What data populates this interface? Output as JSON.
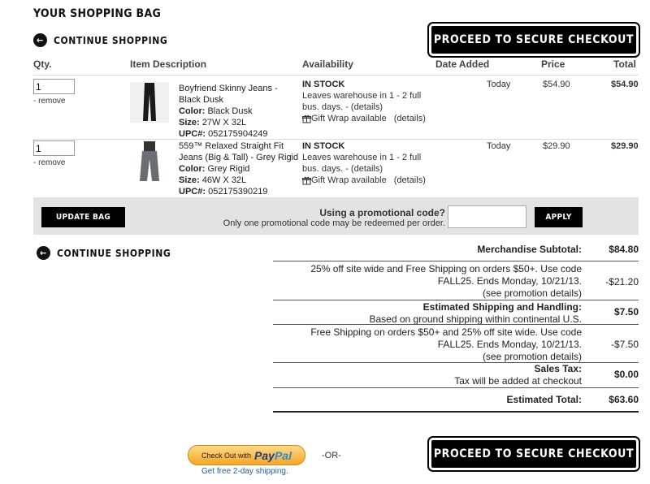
{
  "page_title": "YOUR SHOPPING BAG",
  "continue_shopping": "CONTINUE SHOPPING",
  "checkout_button": "PROCEED TO SECURE CHECKOUT",
  "columns": {
    "qty": "Qty.",
    "item": "Item Description",
    "availability": "Availability",
    "date_added": "Date Added",
    "price": "Price",
    "total": "Total"
  },
  "items": [
    {
      "qty": "1",
      "remove": "- remove",
      "name": "Boyfriend Skinny Jeans - Black Dusk",
      "color_label": "Color:",
      "color": "Black Dusk",
      "size_label": "Size:",
      "size": "27W X 32L",
      "upc_label": "UPC#:",
      "upc": "052175904249",
      "stock": "IN STOCK",
      "leaves": "Leaves warehouse in 1 - 2 full bus. days. - (",
      "details": "details",
      "close_paren": ")",
      "gift_wrap": "Gift Wrap available",
      "gift_details": "(details)",
      "date": "Today",
      "price": "$54.90",
      "total": "$54.90"
    },
    {
      "qty": "1",
      "remove": "- remove",
      "name": "559™ Relaxed Straight Fit Jeans (Big & Tall) - Grey Rigid",
      "color_label": "Color:",
      "color": "Grey Rigid",
      "size_label": "Size:",
      "size": "46W X 32L",
      "upc_label": "UPC#:",
      "upc": "052175390219",
      "stock": "IN STOCK",
      "leaves": "Leaves warehouse in 1 - 2 full bus. days. - (",
      "details": "details",
      "close_paren": ")",
      "gift_wrap": "Gift Wrap available",
      "gift_details": "(details)",
      "date": "Today",
      "price": "$29.90",
      "total": "$29.90"
    }
  ],
  "update_bag": "UPDATE BAG",
  "promo": {
    "heading": "Using a promotional code?",
    "note": "Only one promotional code may be redeemed per order.",
    "value": "",
    "apply": "APPLY"
  },
  "summary": {
    "subtotal_label": "Merchandise Subtotal:",
    "subtotal": "$84.80",
    "promo1_text": "25% off site wide and Free Shipping on orders $50+. Use code FALL25. Ends Monday, 10/21/13.",
    "promo1_link": "(see promotion details)",
    "promo1_value": "-$21.20",
    "shipping_label": "Estimated Shipping and Handling:",
    "shipping_note": "Based on ground shipping within continental U.S.",
    "shipping": "$7.50",
    "promo2_text": "Free Shipping on orders $50+ and 25% off site wide. Use code FALL25. Ends Monday, 10/21/13.",
    "promo2_link": "(see promotion details)",
    "promo2_value": "-$7.50",
    "tax_label": "Sales Tax:",
    "tax_note": "Tax will be added at checkout",
    "tax": "$0.00",
    "total_label": "Estimated Total:",
    "total": "$63.60"
  },
  "paypal": {
    "check_out_with": "Check Out with",
    "pay": "Pay",
    "pal": "Pal",
    "free_shipping": "Get free 2-day shipping."
  },
  "or": "-OR-"
}
